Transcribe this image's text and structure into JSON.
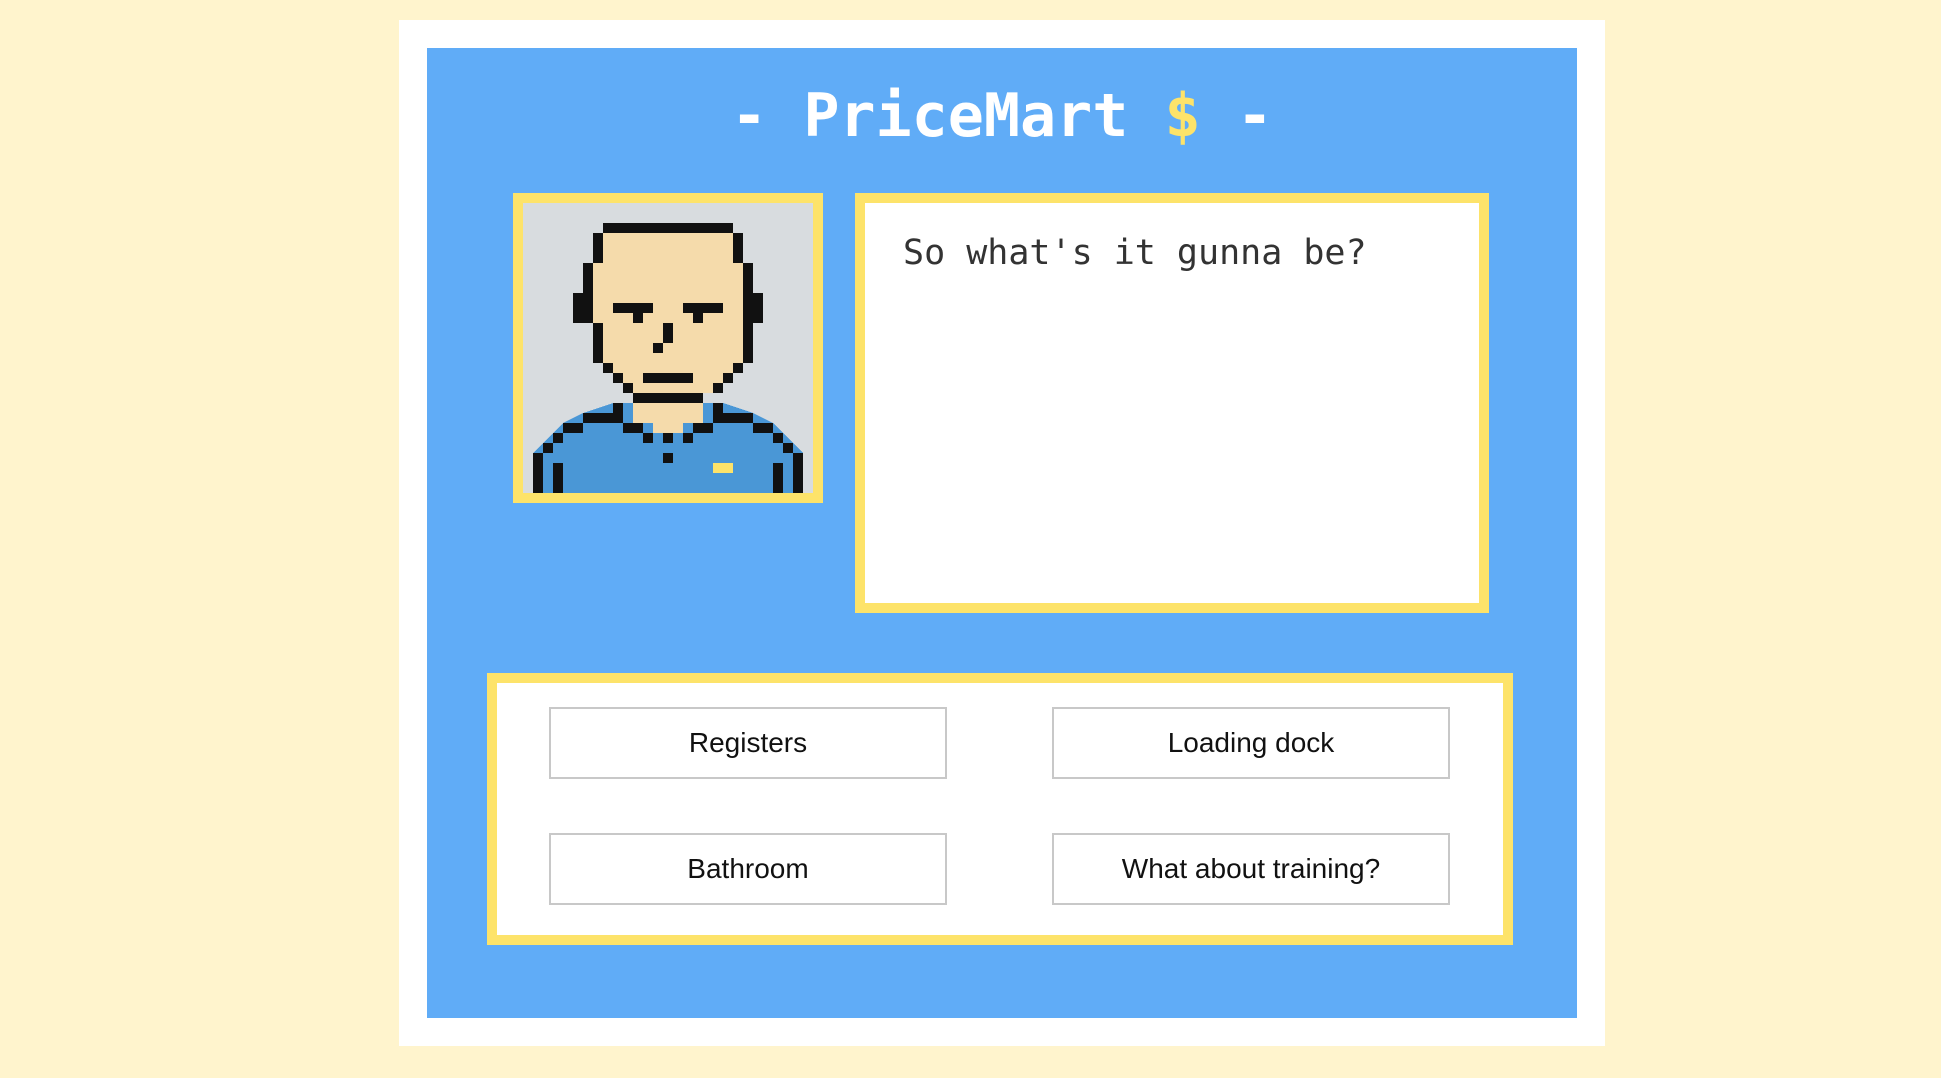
{
  "header": {
    "title_prefix": "- ",
    "brand": "PriceMart",
    "currency_symbol": "$",
    "title_suffix": " -"
  },
  "npc": {
    "portrait_icon": "bald-manager-portrait-icon"
  },
  "dialog": {
    "text": "So what's it gunna be?"
  },
  "choices": [
    {
      "label": "Registers"
    },
    {
      "label": "Loading dock"
    },
    {
      "label": "Bathroom"
    },
    {
      "label": "What about training?"
    }
  ],
  "colors": {
    "page_background": "#fff4cd",
    "game_background": "#60acf7",
    "border_accent": "#fde36a",
    "skin": "#f5dbab",
    "shirt": "#4a97d6"
  }
}
